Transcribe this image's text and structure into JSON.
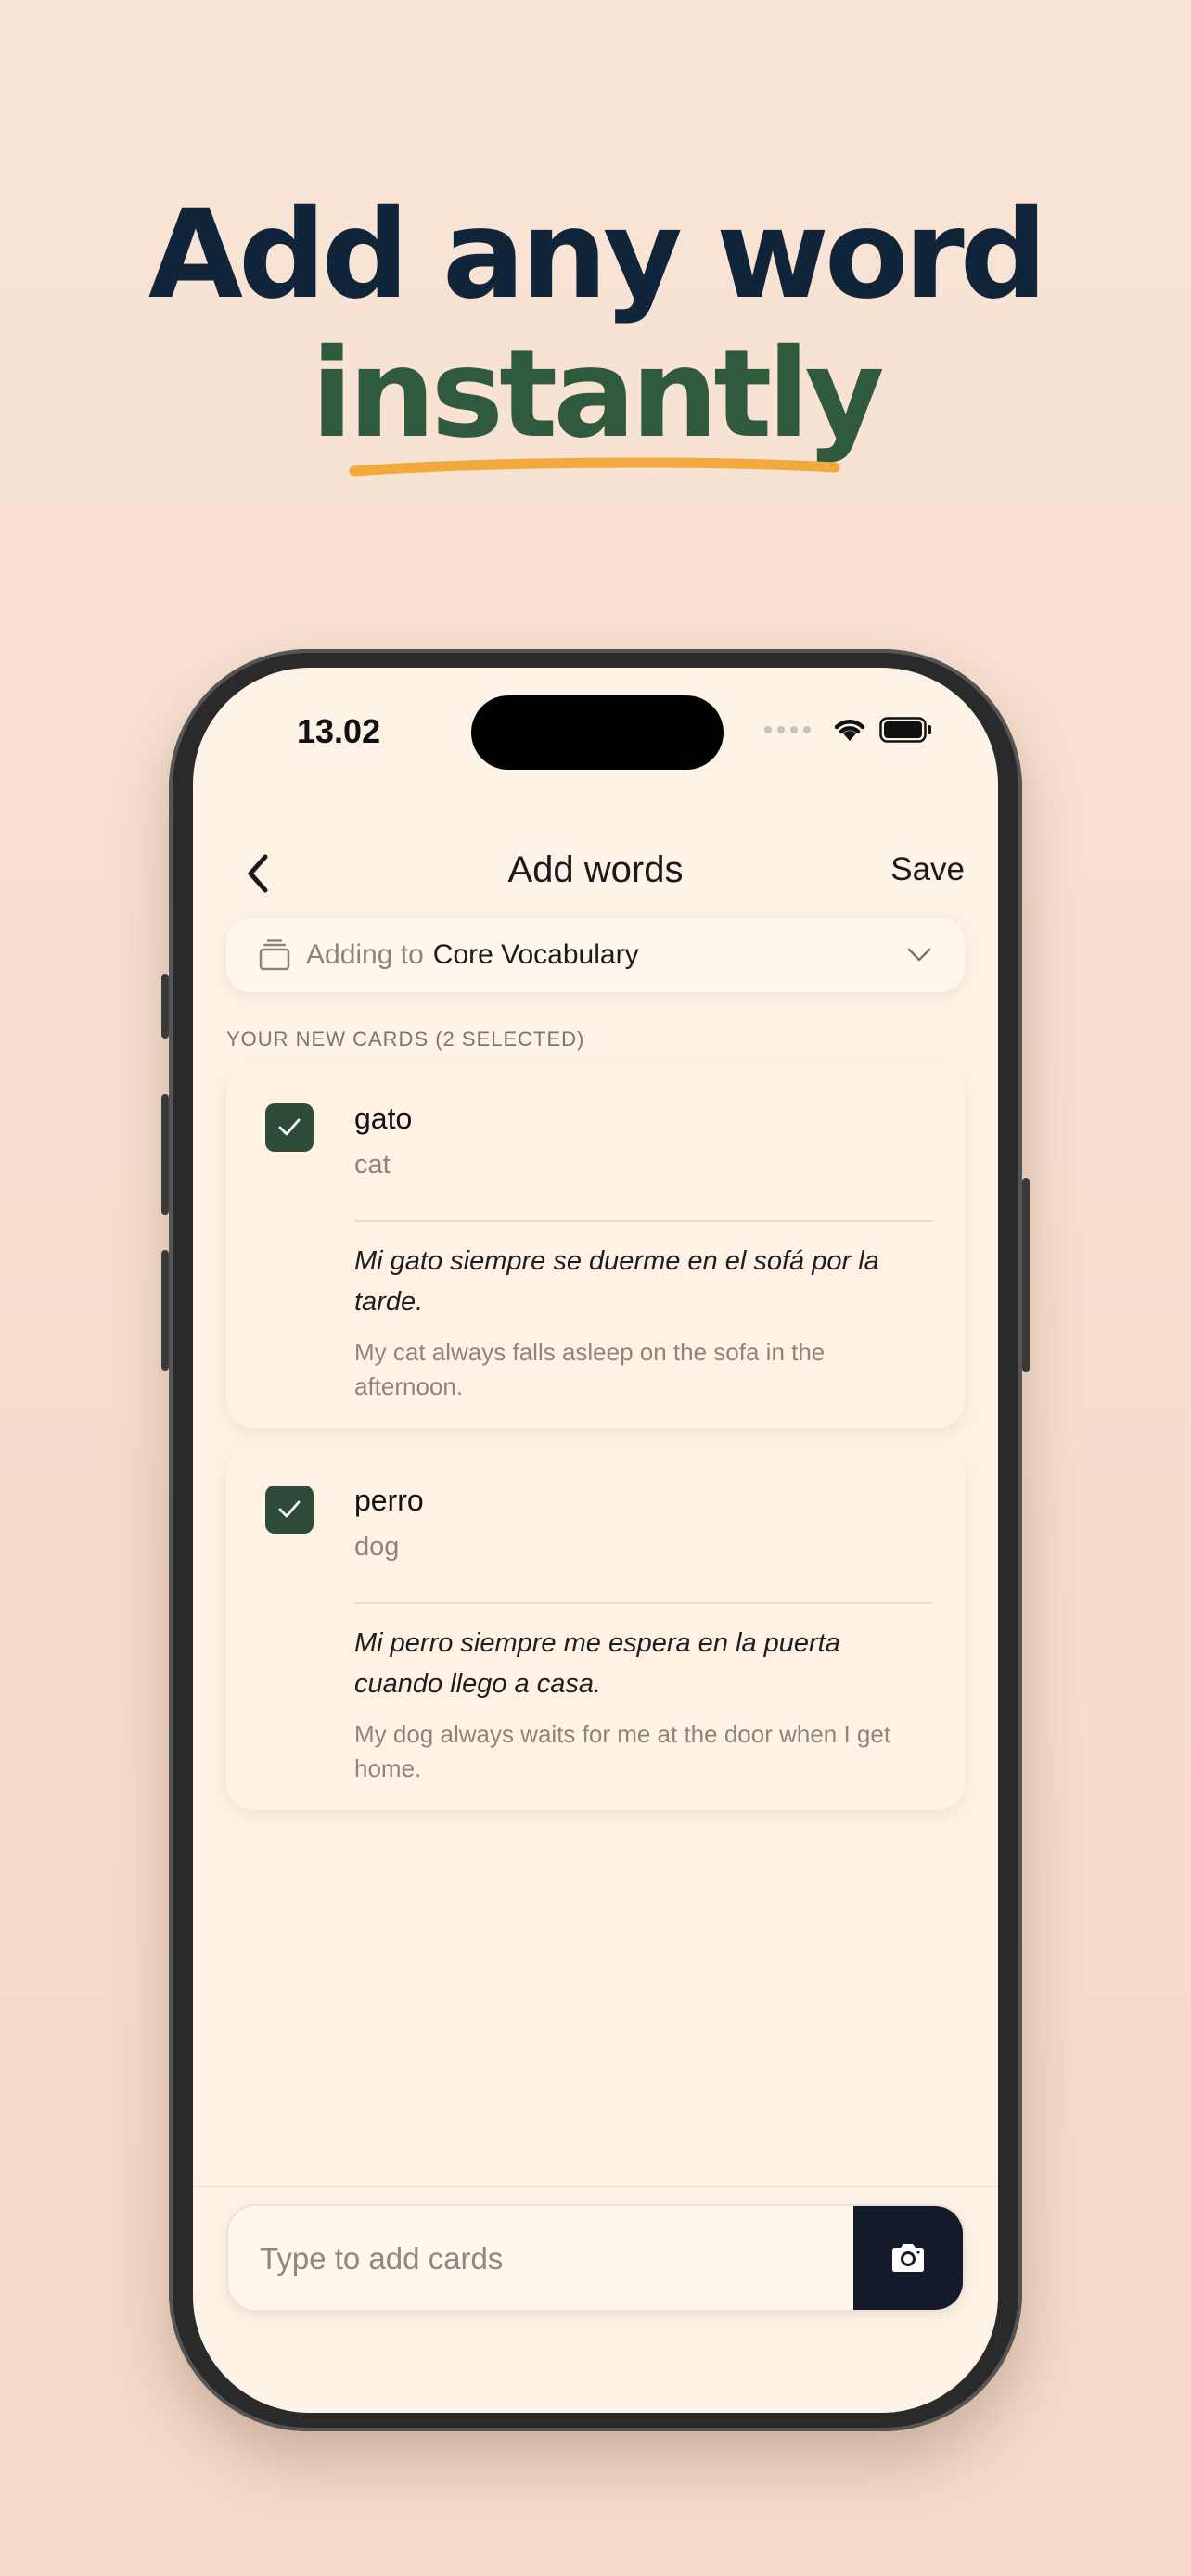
{
  "headline": {
    "line1": "Add any word",
    "line2": "instantly"
  },
  "colors": {
    "headline_dark": "#11253a",
    "headline_green": "#2f5a3e",
    "underline": "#f2a93b",
    "check_green": "#2f4c3a",
    "camera_button": "#141a2a"
  },
  "status_bar": {
    "time": "13.02",
    "icons": [
      "signal-dots-icon",
      "wifi-icon",
      "battery-icon"
    ]
  },
  "nav": {
    "title": "Add words",
    "save_label": "Save",
    "back_icon": "chevron-left-icon"
  },
  "deck_selector": {
    "prefix": "Adding to",
    "deck_name": "Core Vocabulary",
    "icon": "deck-stack-icon",
    "dropdown_icon": "chevron-down-icon"
  },
  "section_label": "YOUR NEW CARDS (2 SELECTED)",
  "cards": [
    {
      "checked": true,
      "word": "gato",
      "translation": "cat",
      "example": "Mi gato siempre se duerme en el sofá por la tarde.",
      "example_translation": "My cat always falls asleep on the sofa in the afternoon."
    },
    {
      "checked": true,
      "word": "perro",
      "translation": "dog",
      "example": "Mi perro siempre me espera en la puerta cuando llego a casa.",
      "example_translation": "My dog always waits for me at the door when I get home."
    }
  ],
  "input": {
    "placeholder": "Type to add cards",
    "value": "",
    "camera_icon": "camera-icon"
  }
}
